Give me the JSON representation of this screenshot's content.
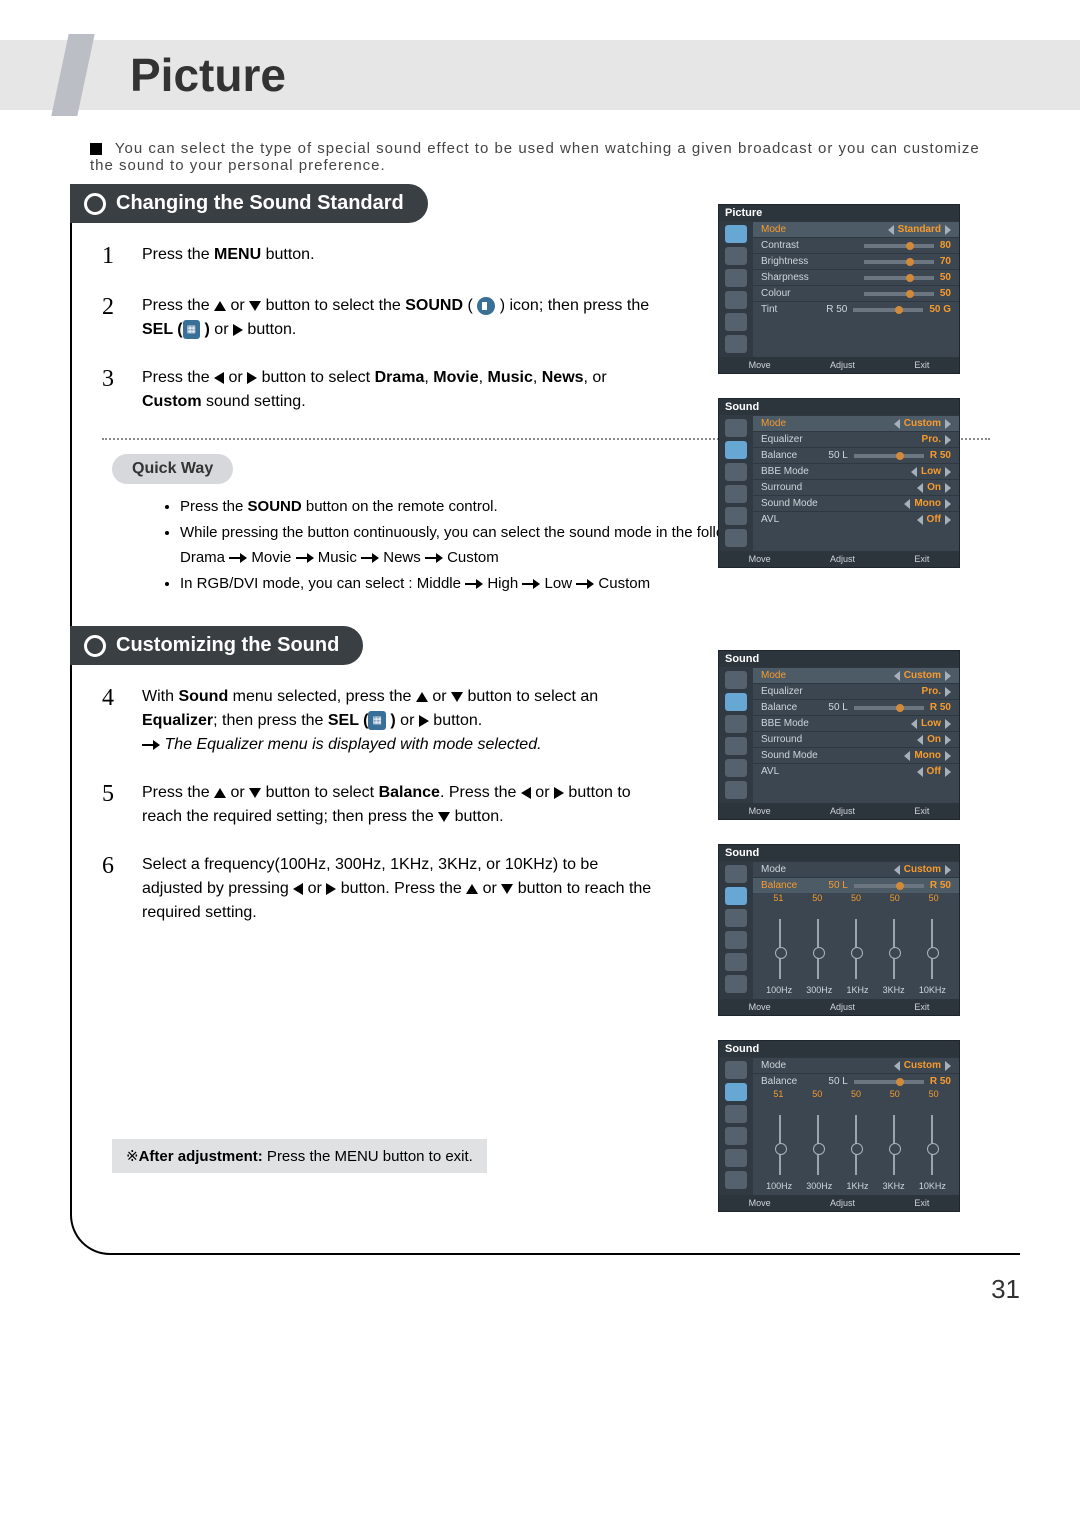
{
  "page": {
    "title": "Picture",
    "number": "31"
  },
  "intro": "You can select the type of special sound effect to be used when watching a given broadcast or you can customize the sound to your personal preference.",
  "section1": {
    "title": "Changing the Sound Standard"
  },
  "step1": {
    "num": "1",
    "a": "Press the ",
    "b": "MENU",
    "c": " button."
  },
  "step2": {
    "num": "2",
    "a": "Press the ",
    "b": " or ",
    "c": " button to select the ",
    "d": "SOUND",
    "e": " ( ",
    "f": " ) icon; then press the ",
    "g": "SEL (",
    "h": " )",
    "i": " or ",
    "j": " button."
  },
  "step3": {
    "num": "3",
    "a": "Press the ",
    "b": " or ",
    "c": " button to select ",
    "d": "Drama",
    "e": ", ",
    "f": "Movie",
    "g": ", ",
    "h": "Music",
    "i": ", ",
    "j": "News",
    "k": ", or ",
    "l": "Custom",
    "m": " sound setting."
  },
  "quick": {
    "title": "Quick Way",
    "li1a": "Press the ",
    "li1b": "SOUND",
    "li1c": " button on the remote control.",
    "li2": "While pressing the button continuously, you can select the sound mode in the following sequence:",
    "seq1": [
      "Drama",
      "Movie",
      "Music",
      "News",
      "Custom"
    ],
    "li3a": "In RGB/DVI mode, you can select : ",
    "seq2": [
      "Middle",
      "High",
      "Low",
      "Custom"
    ]
  },
  "section2": {
    "title": "Customizing the Sound"
  },
  "step4": {
    "num": "4",
    "a": "With ",
    "b": "Sound",
    "c": " menu selected, press the ",
    "d": " or ",
    "e": " button to select an ",
    "f": "Equalizer",
    "g": "; then press the ",
    "h": "SEL (",
    "i": " )",
    "j": " or ",
    "k": " button.",
    "note": "The Equalizer menu is displayed with mode selected."
  },
  "step5": {
    "num": "5",
    "a": "Press the ",
    "b": " or ",
    "c": " button to select ",
    "d": "Balance",
    "e": ". Press the ",
    "f": " or ",
    "g": " button to reach the required setting; then press the ",
    "h": " button."
  },
  "step6": {
    "num": "6",
    "a": "Select a frequency(100Hz, 300Hz, 1KHz, 3KHz, or 10KHz) to be adjusted by pressing ",
    "b": " or ",
    "c": " button. Press the ",
    "d": " or ",
    "e": " button to reach the required setting."
  },
  "after": {
    "a": "※",
    "b": "After adjustment:",
    "c": " Press the MENU button to exit."
  },
  "osd_picture": {
    "title": "Picture",
    "rows": [
      {
        "label": "Mode",
        "value": "Standard",
        "arrows": true
      },
      {
        "label": "Contrast",
        "value": "80",
        "slider": true
      },
      {
        "label": "Brightness",
        "value": "70",
        "slider": true
      },
      {
        "label": "Sharpness",
        "value": "50",
        "slider": true
      },
      {
        "label": "Colour",
        "value": "50",
        "slider": true
      },
      {
        "label": "Tint",
        "left": "R 50",
        "value": "50 G",
        "slider": true
      }
    ],
    "foot": [
      "Move",
      "Adjust",
      "Exit"
    ]
  },
  "osd_sound": {
    "title": "Sound",
    "rows": [
      {
        "label": "Mode",
        "value": "Custom",
        "arrows": true
      },
      {
        "label": "Equalizer",
        "value": "Pro.",
        "arrows_r": true
      },
      {
        "label": "Balance",
        "left": "50 L",
        "value": "R 50",
        "slider": true
      },
      {
        "label": "BBE Mode",
        "value": "Low",
        "arrows": true
      },
      {
        "label": "Surround",
        "value": "On",
        "arrows": true
      },
      {
        "label": "Sound Mode",
        "value": "Mono",
        "arrows": true
      },
      {
        "label": "AVL",
        "value": "Off",
        "arrows": true
      }
    ],
    "foot": [
      "Move",
      "Adjust",
      "Exit"
    ]
  },
  "osd_eq": {
    "title": "Sound",
    "mode_label": "Mode",
    "mode_value": "Custom",
    "bal_label": "Balance",
    "bal_left": "50 L",
    "bal_right": "R 50",
    "freqs": [
      "100Hz",
      "300Hz",
      "1KHz",
      "3KHz",
      "10KHz"
    ],
    "vals": [
      "51",
      "50",
      "50",
      "50",
      "50"
    ],
    "foot": [
      "Move",
      "Adjust",
      "Exit"
    ]
  }
}
